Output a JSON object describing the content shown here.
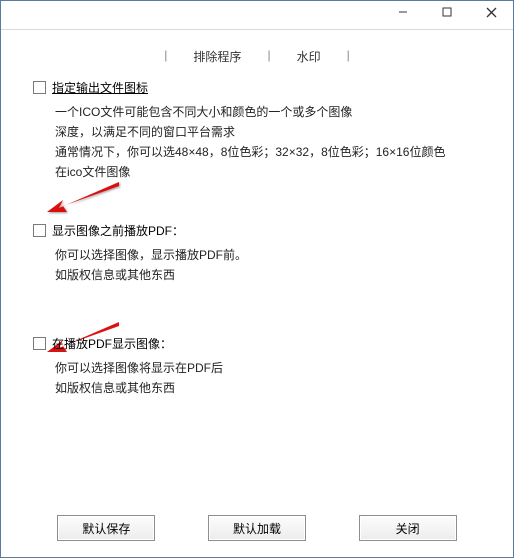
{
  "tabs": {
    "item1": "排除程序",
    "item2": "水印"
  },
  "section1": {
    "title": "指定输出文件图标",
    "line1": "一个ICO文件可能包含不同大小和颜色的一个或多个图像",
    "line2": "深度，以满足不同的窗口平台需求",
    "line3": "通常情况下，你可以选48×48，8位色彩；32×32，8位色彩；16×16位颜色",
    "line4": "在ico文件图像"
  },
  "section2": {
    "title": "显示图像之前播放PDF：",
    "line1": "你可以选择图像，显示播放PDF前。",
    "line2": "如版权信息或其他东西"
  },
  "section3": {
    "title": "在播放PDF显示图像：",
    "line1": "你可以选择图像将显示在PDF后",
    "line2": "如版权信息或其他东西"
  },
  "buttons": {
    "save": "默认保存",
    "load": "默认加载",
    "close": "关闭"
  }
}
